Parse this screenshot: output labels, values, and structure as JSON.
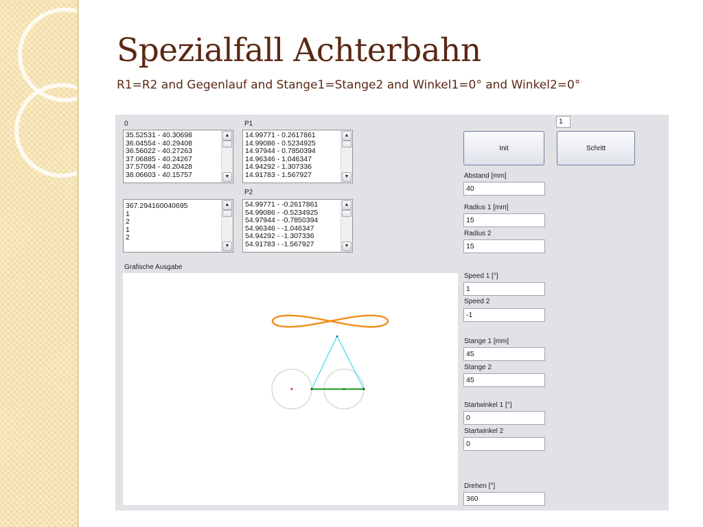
{
  "slide": {
    "title": "Spezialfall Achterbahn",
    "subtitle": "R1=R2 and Gegenlauf and Stange1=Stange2 and Winkel1=0° and Winkel2=0°"
  },
  "app": {
    "list_o": {
      "label": "0",
      "rows": [
        "35.52531 - 40.30698",
        "36.04554 - 40.29408",
        "36.56022 - 40.27263",
        "37.06885 - 40.24267",
        "37.57094 - 40.20428",
        "38.06603 - 40.15757"
      ]
    },
    "list_p1": {
      "label": "P1",
      "rows": [
        "14.99771 - 0.2617861",
        "14.99086 - 0.5234925",
        "14.97944 - 0.7850394",
        "14.96346 - 1.046347",
        "14.94292 - 1.307336",
        "14.91783 - 1.567927"
      ]
    },
    "list_info": {
      "rows": [
        "367.294160040695",
        "1",
        "2",
        "1",
        "2"
      ]
    },
    "list_p2": {
      "label": "P2",
      "rows": [
        "54.99771 - -0.2617861",
        "54.99086 - -0.5234925",
        "54.97944 - -0.7850394",
        "54.96346 - -1.046347",
        "54.94292 - -1.307336",
        "54.91783 - -1.567927"
      ]
    },
    "canvas_label": "Grafische Ausgabe",
    "step_count": "1",
    "buttons": {
      "init": "Init",
      "step": "Schritt"
    },
    "fields": {
      "abstand": {
        "label": "Abstand [mm]",
        "value": "40"
      },
      "radius1": {
        "label": "Radius 1 [mm]",
        "value": "15"
      },
      "radius2": {
        "label": "Radius 2",
        "value": "15"
      },
      "speed1": {
        "label": "Speed 1 [°]",
        "value": "1"
      },
      "speed2": {
        "label": "Speed 2",
        "value": "-1"
      },
      "stange1": {
        "label": "Stange 1 [mm]",
        "value": "45"
      },
      "stange2": {
        "label": "Stange 2",
        "value": "45"
      },
      "startwinkel1": {
        "label": "Startwinkel 1 [°]",
        "value": "0"
      },
      "startwinkel2": {
        "label": "Startwinkel 2",
        "value": "0"
      },
      "drehen": {
        "label": "Drehen [°]",
        "value": "360"
      }
    },
    "colors": {
      "curve": "#f0901e",
      "rods": "#38d8e8",
      "ground_link": "#20a020",
      "center_dot": "#e02020",
      "circle": "#c8c8c8"
    }
  }
}
